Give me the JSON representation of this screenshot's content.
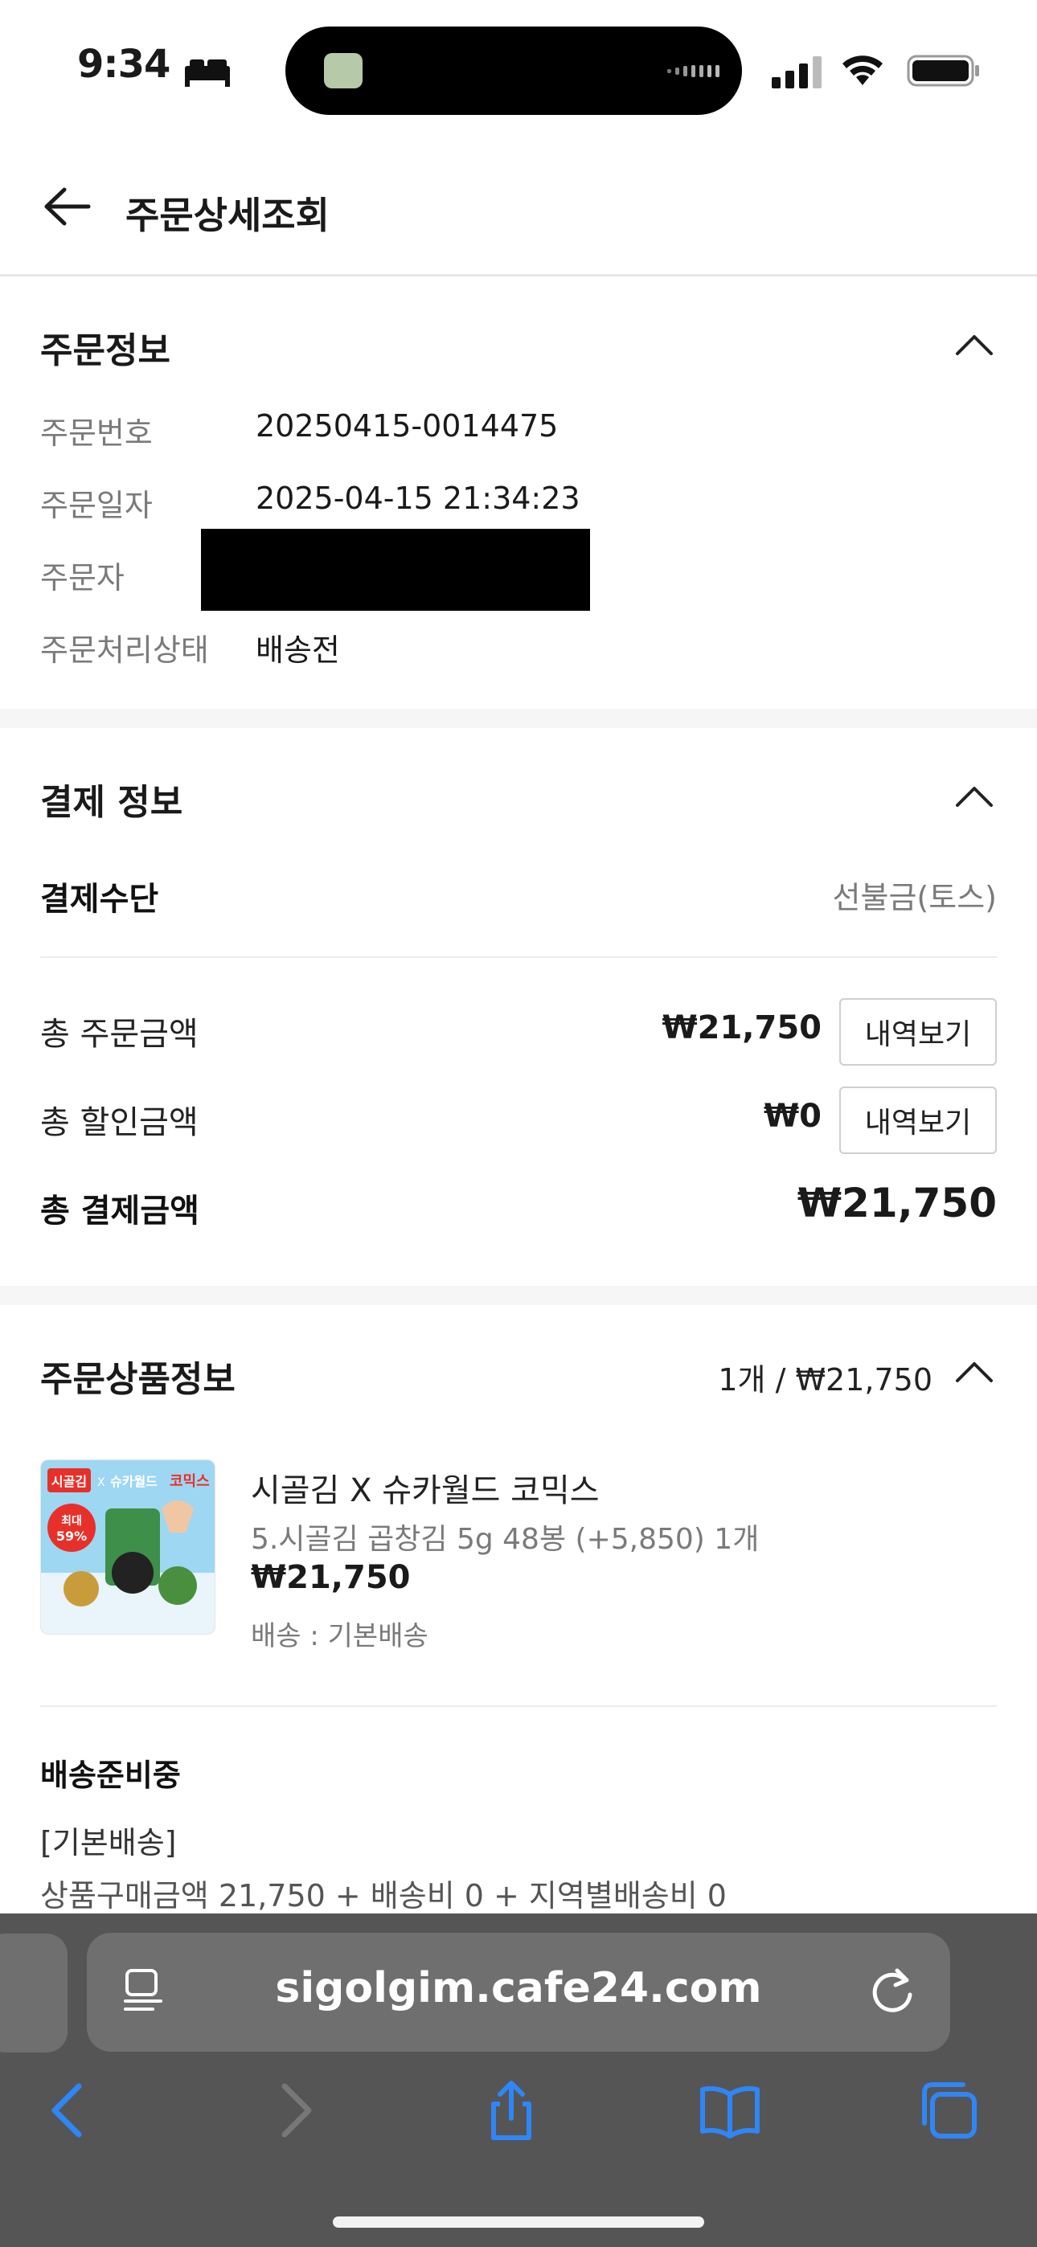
{
  "status_bar": {
    "time": "9:34"
  },
  "header": {
    "title": "주문상세조회"
  },
  "order_info": {
    "title": "주문정보",
    "rows": [
      {
        "label": "주문번호",
        "value": "20250415-0014475"
      },
      {
        "label": "주문일자",
        "value": "2025-04-15 21:34:23"
      },
      {
        "label": "주문자",
        "value": ""
      },
      {
        "label": "주문처리상태",
        "value": "배송전"
      }
    ]
  },
  "payment_info": {
    "title": "결제 정보",
    "method_label": "결제수단",
    "method_value": "선불금(토스)",
    "total_order_label": "총 주문금액",
    "total_order_value": "₩21,750",
    "total_discount_label": "총 할인금액",
    "total_discount_value": "₩0",
    "total_payment_label": "총 결제금액",
    "total_payment_value": "₩21,750",
    "detail_button": "내역보기"
  },
  "product_info": {
    "title": "주문상품정보",
    "summary": "1개 / ₩21,750",
    "product": {
      "name": "시골김 X 슈카월드 코믹스",
      "option": "5.시골김 곱창김 5g 48봉 (+5,850) 1개",
      "price": "₩21,750",
      "shipping": "배송 : 기본배송",
      "image_text": {
        "brand": "시골김",
        "x": "X",
        "collab": "슈카월드",
        "comics": "코믹스",
        "badge_top": "최대",
        "badge_bottom": "59%"
      }
    },
    "status": "배송준비중",
    "shipping_type": "[기본배송]",
    "shipping_calc": "상품구매금액 21,750 + 배송비 0 + 지역별배송비 0"
  },
  "browser": {
    "url": "sigolgim.cafe24.com"
  },
  "colors": {
    "accent_blue": "#2f86f6",
    "browser_bg": "#555556",
    "text": "#1a1a1a",
    "muted": "#7a7a7a"
  }
}
